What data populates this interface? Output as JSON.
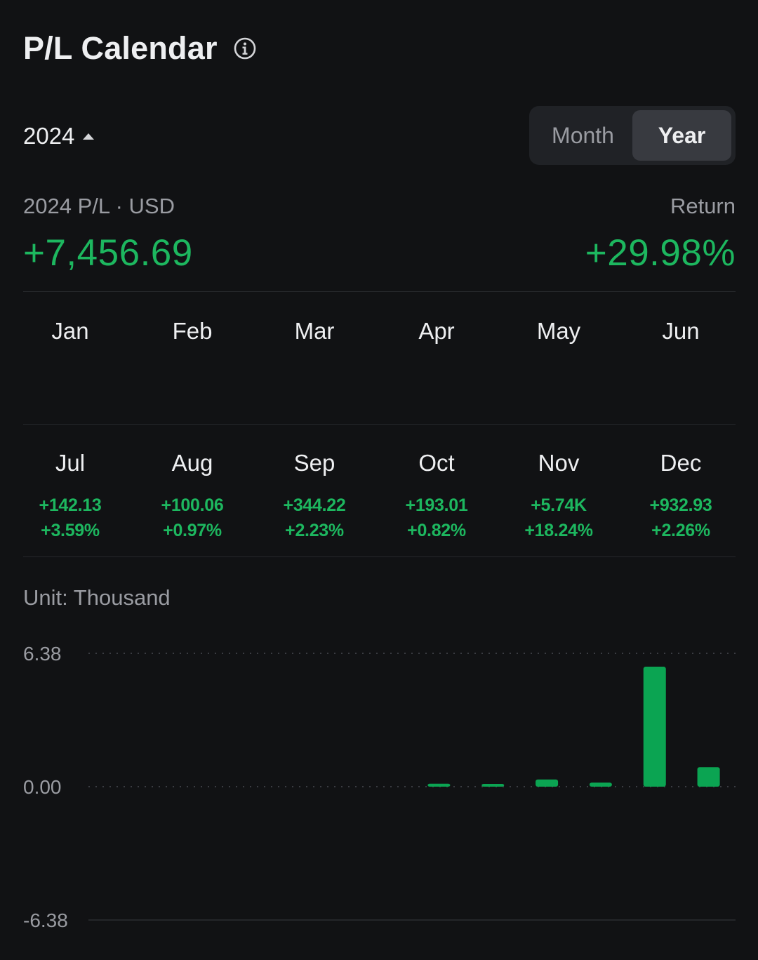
{
  "header": {
    "title": "P/L Calendar",
    "info_icon": "info-circle-icon"
  },
  "controls": {
    "year": "2024",
    "year_caret_icon": "caret-up-icon",
    "toggle": {
      "month_label": "Month",
      "year_label": "Year",
      "selected": "Year"
    }
  },
  "summary": {
    "pl_label": "2024 P/L · USD",
    "pl_value": "+7,456.69",
    "return_label": "Return",
    "return_value": "+29.98%"
  },
  "months": [
    {
      "name": "Jan",
      "pl": "",
      "rate": ""
    },
    {
      "name": "Feb",
      "pl": "",
      "rate": ""
    },
    {
      "name": "Mar",
      "pl": "",
      "rate": ""
    },
    {
      "name": "Apr",
      "pl": "",
      "rate": ""
    },
    {
      "name": "May",
      "pl": "",
      "rate": ""
    },
    {
      "name": "Jun",
      "pl": "",
      "rate": ""
    },
    {
      "name": "Jul",
      "pl": "+142.13",
      "rate": "+3.59%"
    },
    {
      "name": "Aug",
      "pl": "+100.06",
      "rate": "+0.97%"
    },
    {
      "name": "Sep",
      "pl": "+344.22",
      "rate": "+2.23%"
    },
    {
      "name": "Oct",
      "pl": "+193.01",
      "rate": "+0.82%"
    },
    {
      "name": "Nov",
      "pl": "+5.74K",
      "rate": "+18.24%"
    },
    {
      "name": "Dec",
      "pl": "+932.93",
      "rate": "+2.26%"
    }
  ],
  "colors": {
    "background": "#111214",
    "positive": "#1db75f",
    "bar": "#0ba452",
    "muted_text": "#9a9ca2",
    "toggle_bg": "#202226",
    "toggle_selected_bg": "#383a40"
  },
  "chart_data": {
    "type": "bar",
    "unit_label": "Unit: Thousand",
    "categories": [
      "Jan",
      "Feb",
      "Mar",
      "Apr",
      "May",
      "Jun",
      "Jul",
      "Aug",
      "Sep",
      "Oct",
      "Nov",
      "Dec"
    ],
    "values": [
      0,
      0,
      0,
      0,
      0,
      0,
      0.14213,
      0.10006,
      0.34422,
      0.19301,
      5.74,
      0.93293
    ],
    "ylim": [
      -6.38,
      6.38
    ],
    "y_ticks": [
      "6.38",
      "0.00",
      "-6.38"
    ],
    "grid": "dotted at top and zero, solid at bottom",
    "xlabel": "",
    "ylabel": ""
  }
}
